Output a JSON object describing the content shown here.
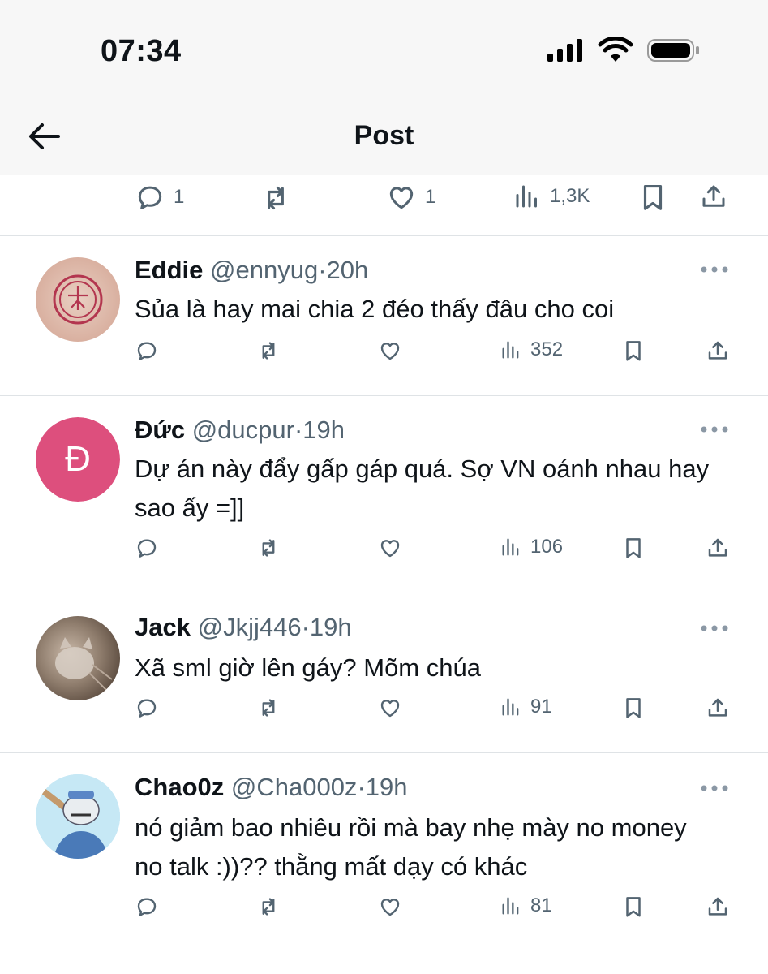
{
  "status": {
    "time": "07:34"
  },
  "nav": {
    "title": "Post"
  },
  "top_actions": {
    "replies": "1",
    "likes": "1",
    "views": "1,3K"
  },
  "replies": [
    {
      "name": "Eddie",
      "handle": "@ennyug",
      "sep": "·",
      "time": "20h",
      "text": "Sủa là hay mai chia 2 đéo thấy đâu cho coi",
      "views": "352"
    },
    {
      "name": "Đức",
      "handle": "@ducpur",
      "sep": "·",
      "time": "19h",
      "text": "Dự án này đẩy gấp gáp quá. Sợ VN oánh nhau hay sao ấy =]]",
      "views": "106",
      "avatar_letter": "Đ",
      "avatar_color": "#dd4f7d"
    },
    {
      "name": "Jack",
      "handle": "@Jkjj446",
      "sep": "·",
      "time": "19h",
      "text": "Xã sml giờ lên gáy? Mõm chúa",
      "views": "91"
    },
    {
      "name": "Chao0z",
      "handle": "@Cha000z",
      "sep": "·",
      "time": "19h",
      "text": "nó giảm bao nhiêu rồi mà bay nhẹ mày no money no talk :))?? thằng mất dạy có khác",
      "views": "81"
    }
  ]
}
